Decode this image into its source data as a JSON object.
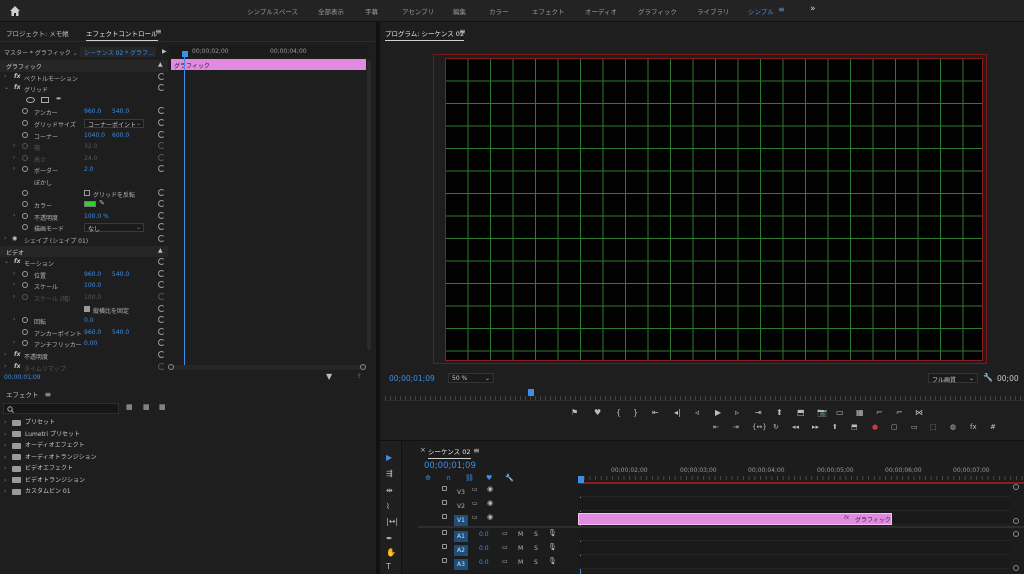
{
  "topbar": {
    "workspaces": [
      "シンプルスペース",
      "全部表示",
      "字幕",
      "アセンブリ",
      "編集",
      "カラー",
      "エフェクト",
      "オーディオ",
      "グラフィック",
      "ライブラリ",
      "シンプル"
    ],
    "active_index": 10,
    "menu_glyph": "≡",
    "more_glyph": "»"
  },
  "left_top": {
    "tab_project": "プロジェクト: メモ帳",
    "tab_effect_controls": "エフェクトコントロール",
    "menu_glyph": "≡",
    "master_label": "マスター * グラフィック",
    "sequence_label": "シーケンス 02 * グラフ…",
    "time_marks": [
      "00;00;02;00",
      "00;00;04;00"
    ],
    "clip_label": "グラフィック",
    "timecode": "00;00;01;09",
    "rows": [
      {
        "label": "グラフィック",
        "section": true
      },
      {
        "label": "ベクトルモーション",
        "fx": true,
        "twirl": "›"
      },
      {
        "label": "グリッド",
        "fx": true,
        "twirl": "⌄"
      },
      {
        "label": "アンカー",
        "v1": "960.0",
        "v2": "540.0",
        "sw": true
      },
      {
        "label": "グリッドサイズ",
        "dd": "コーナーポイント",
        "sw": true
      },
      {
        "label": "コーナー",
        "v1": "1040.0",
        "v2": "600.0",
        "sw": true
      },
      {
        "label": "幅",
        "v1": "32.0",
        "dim": true,
        "twirl": "›",
        "sw": true
      },
      {
        "label": "高さ",
        "v1": "24.0",
        "dim": true,
        "twirl": "›",
        "sw": true
      },
      {
        "label": "ボーダー",
        "v1": "2.0",
        "twirl": "›",
        "sw": true
      },
      {
        "label": "ぼかし"
      },
      {
        "label": "",
        "check": "グリッドを反転",
        "sw": true
      },
      {
        "label": "カラー",
        "color": "#29d629",
        "sw": true
      },
      {
        "label": "不透明度",
        "v1": "100.0 %",
        "twirl": "›",
        "sw": true
      },
      {
        "label": "描画モード",
        "dd": "なし",
        "sw": true
      },
      {
        "label": "シェイプ (シェイプ 01)",
        "eye": true,
        "twirl": "›"
      },
      {
        "label": "ビデオ",
        "section": true
      },
      {
        "label": "モーション",
        "fx": true,
        "twirl": "⌄"
      },
      {
        "label": "位置",
        "v1": "960.0",
        "v2": "540.0",
        "twirl": "›",
        "sw": true
      },
      {
        "label": "スケール",
        "v1": "100.0",
        "twirl": "›",
        "sw": true
      },
      {
        "label": "スケール (幅)",
        "v1": "100.0",
        "dim": true,
        "twirl": "›",
        "sw": true
      },
      {
        "label": "",
        "check": "縦横比を固定",
        "checked": true
      },
      {
        "label": "回転",
        "v1": "0.0",
        "twirl": "›",
        "sw": true
      },
      {
        "label": "アンカーポイント",
        "v1": "960.0",
        "v2": "540.0",
        "sw": true
      },
      {
        "label": "アンチフリッカー",
        "v1": "0.00",
        "twirl": "›",
        "sw": true
      },
      {
        "label": "不透明度",
        "fx": true,
        "twirl": "›"
      },
      {
        "label": "タイムリマップ",
        "fx": true,
        "twirl": "›",
        "dim": true
      }
    ]
  },
  "effects": {
    "tab": "エフェクト",
    "menu_glyph": "≡",
    "search_placeholder": "",
    "items": [
      "プリセット",
      "Lumetri プリセット",
      "オーディオエフェクト",
      "オーディオトランジション",
      "ビデオエフェクト",
      "ビデオトランジション",
      "カスタムビン 01"
    ]
  },
  "program": {
    "tab": "プログラム: シーケンス 02",
    "menu_glyph": "≡",
    "timecode": "00;00;01;09",
    "zoom": "50 %",
    "quality": "フル画質",
    "right_timecode": "00;00",
    "grid_color": "#2e7a2e",
    "border_color": "#8b1a1a"
  },
  "timeline": {
    "close_glyph": "×",
    "tab": "シーケンス 02",
    "menu_glyph": "≡",
    "timecode": "00;00;01;09",
    "ruler_marks": [
      "00;00;02;00",
      "00;00;03;00",
      "00;00;04;00",
      "00;00;05;00",
      "00;00;06;00",
      "00;00;07;00"
    ],
    "clip_label": "グラフィック",
    "clip_color": "#e08ae0",
    "tracks": [
      {
        "name": "V3",
        "kind": "video"
      },
      {
        "name": "V2",
        "kind": "video"
      },
      {
        "name": "V1",
        "kind": "video",
        "active": true
      },
      {
        "name": "A1",
        "kind": "audio",
        "vol": "0.0"
      },
      {
        "name": "A2",
        "kind": "audio",
        "vol": "0.0"
      },
      {
        "name": "A3",
        "kind": "audio",
        "vol": "0.0"
      }
    ],
    "mute": "M",
    "solo": "S"
  }
}
